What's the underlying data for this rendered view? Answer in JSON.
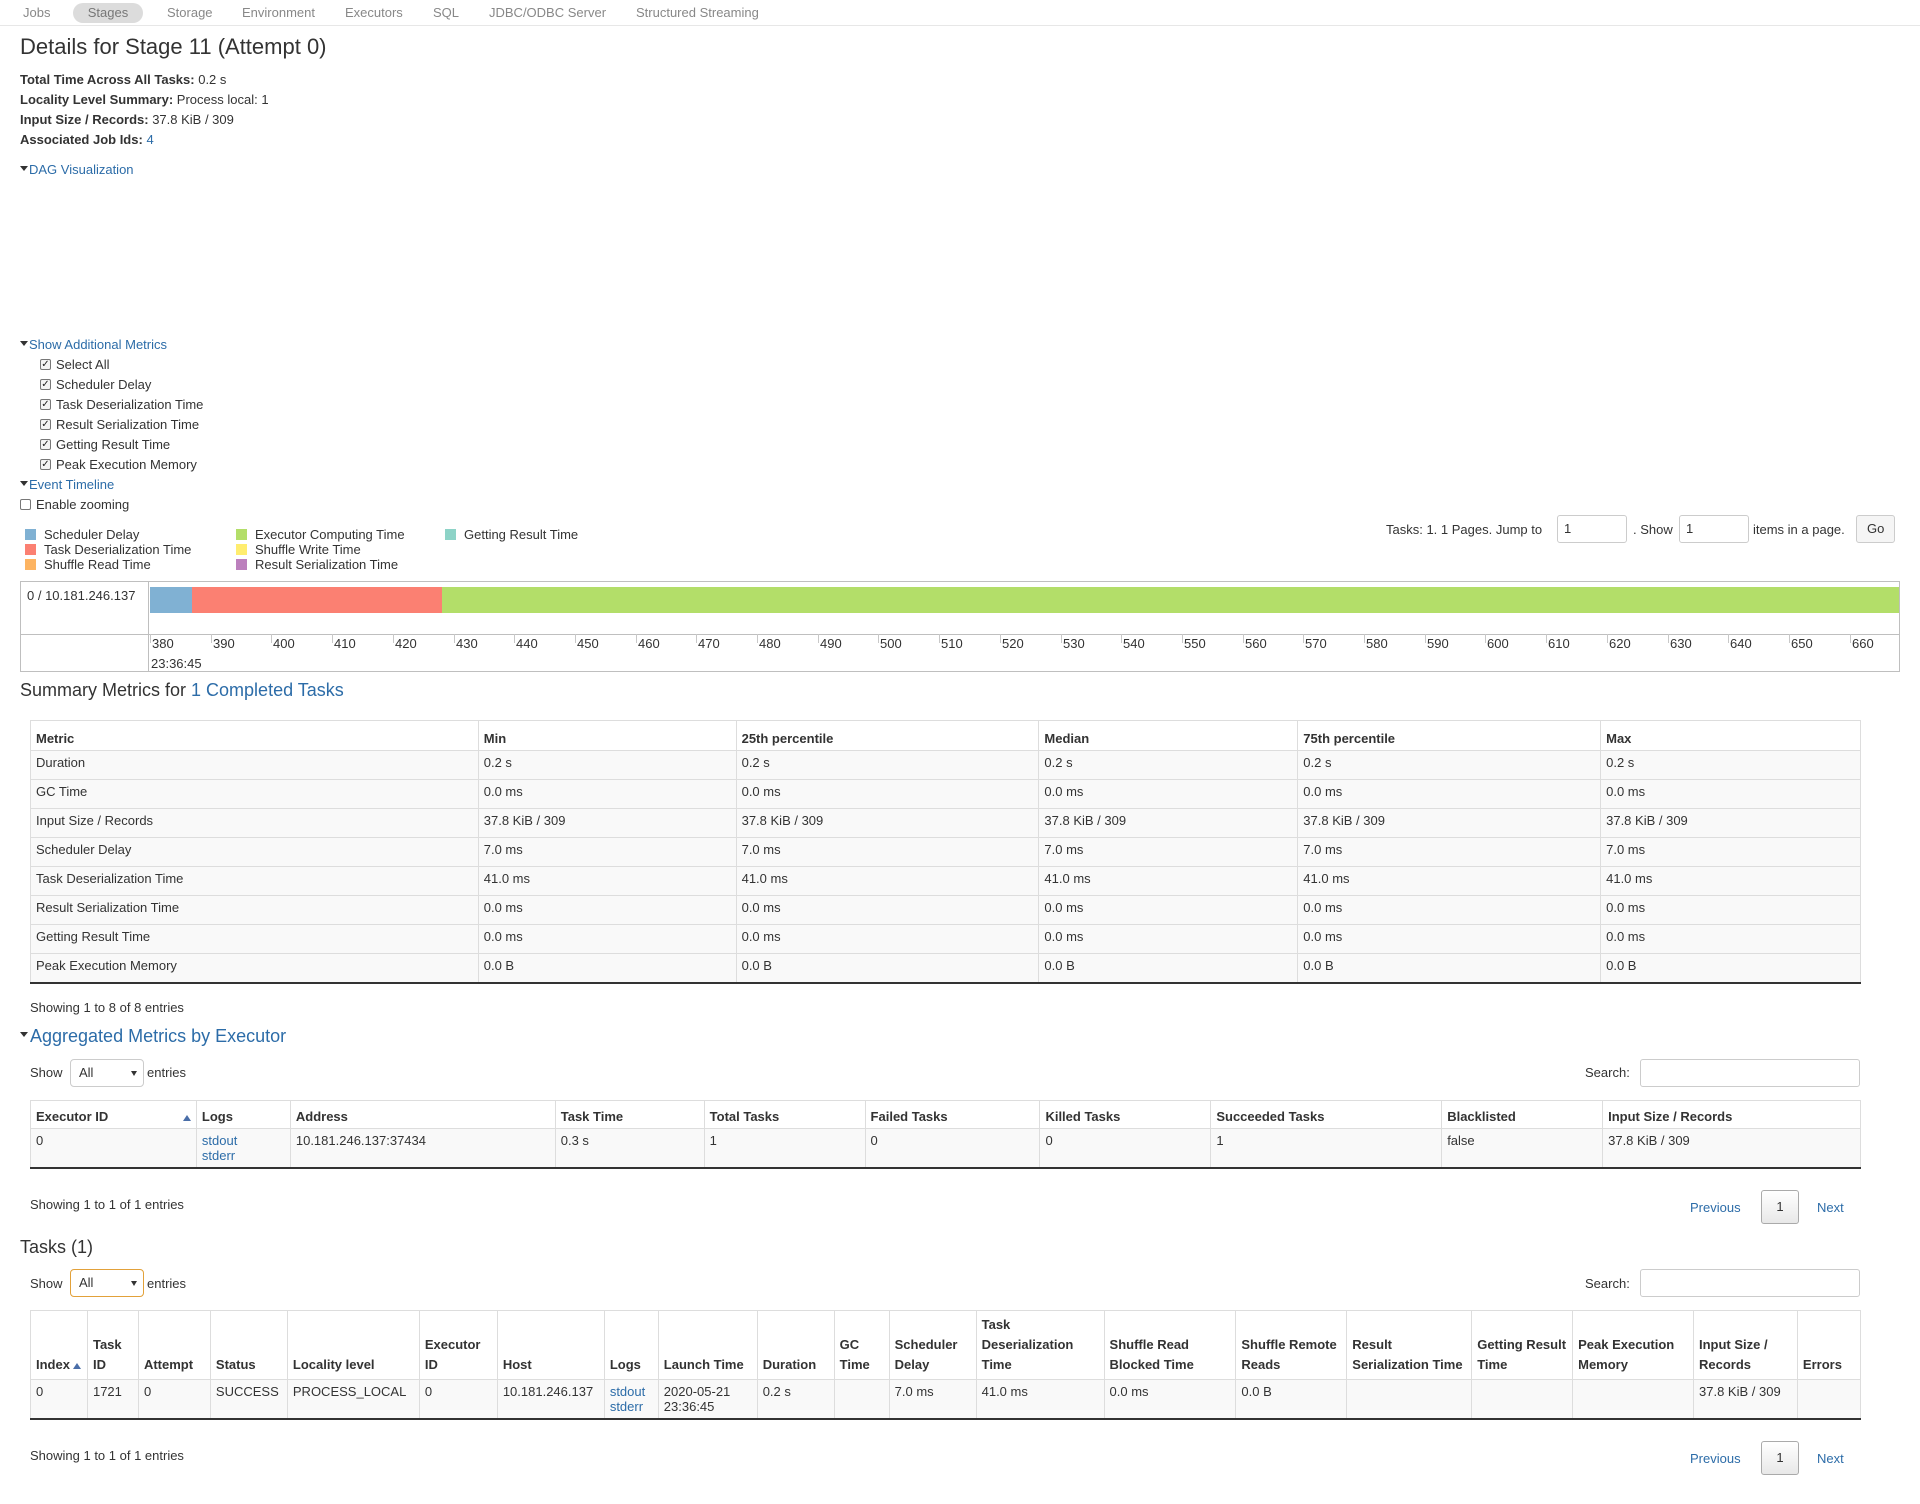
{
  "nav": {
    "items": [
      "Jobs",
      "Stages",
      "Storage",
      "Environment",
      "Executors",
      "SQL",
      "JDBC/ODBC Server",
      "Structured Streaming"
    ],
    "active": "Stages"
  },
  "title": "Details for Stage 11 (Attempt 0)",
  "summary": {
    "total_time_label": "Total Time Across All Tasks:",
    "total_time_value": "0.2 s",
    "locality_label": "Locality Level Summary:",
    "locality_value": "Process local: 1",
    "input_label": "Input Size / Records:",
    "input_value": "37.8 KiB / 309",
    "jobs_label": "Associated Job Ids:",
    "jobs_value": "4"
  },
  "dag_toggle": "DAG Visualization",
  "metrics_toggle": "Show Additional Metrics",
  "metric_checkboxes": [
    "Select All",
    "Scheduler Delay",
    "Task Deserialization Time",
    "Result Serialization Time",
    "Getting Result Time",
    "Peak Execution Memory"
  ],
  "timeline_toggle": "Event Timeline",
  "enable_zooming": "Enable zooming",
  "legend": [
    {
      "label": "Scheduler Delay",
      "color": "#80b1d3"
    },
    {
      "label": "Task Deserialization Time",
      "color": "#fb8072"
    },
    {
      "label": "Shuffle Read Time",
      "color": "#fdb462"
    },
    {
      "label": "Executor Computing Time",
      "color": "#b3de69"
    },
    {
      "label": "Shuffle Write Time",
      "color": "#ffed6f"
    },
    {
      "label": "Result Serialization Time",
      "color": "#bc80bd"
    },
    {
      "label": "Getting Result Time",
      "color": "#8dd3c7"
    }
  ],
  "paging": {
    "tasks_text": "Tasks: 1. 1 Pages. Jump to",
    "jump_value": "1",
    "show_text": ". Show",
    "show_value": "1",
    "items_text": "items in a page.",
    "go": "Go"
  },
  "timeline": {
    "host_label": "0 / 10.181.246.137",
    "ticks": [
      "380",
      "390",
      "400",
      "410",
      "420",
      "430",
      "440",
      "450",
      "460",
      "470",
      "480",
      "490",
      "500",
      "510",
      "520",
      "530",
      "540",
      "550",
      "560",
      "570",
      "580",
      "590",
      "600",
      "610",
      "620",
      "630",
      "640",
      "650",
      "660"
    ],
    "date_label": "23:36:45"
  },
  "summary_metrics": {
    "heading_prefix": "Summary Metrics for ",
    "heading_link": "1 Completed Tasks",
    "columns": [
      "Metric",
      "Min",
      "25th percentile",
      "Median",
      "75th percentile",
      "Max"
    ],
    "rows": [
      [
        "Duration",
        "0.2 s",
        "0.2 s",
        "0.2 s",
        "0.2 s",
        "0.2 s"
      ],
      [
        "GC Time",
        "0.0 ms",
        "0.0 ms",
        "0.0 ms",
        "0.0 ms",
        "0.0 ms"
      ],
      [
        "Input Size / Records",
        "37.8 KiB / 309",
        "37.8 KiB / 309",
        "37.8 KiB / 309",
        "37.8 KiB / 309",
        "37.8 KiB / 309"
      ],
      [
        "Scheduler Delay",
        "7.0 ms",
        "7.0 ms",
        "7.0 ms",
        "7.0 ms",
        "7.0 ms"
      ],
      [
        "Task Deserialization Time",
        "41.0 ms",
        "41.0 ms",
        "41.0 ms",
        "41.0 ms",
        "41.0 ms"
      ],
      [
        "Result Serialization Time",
        "0.0 ms",
        "0.0 ms",
        "0.0 ms",
        "0.0 ms",
        "0.0 ms"
      ],
      [
        "Getting Result Time",
        "0.0 ms",
        "0.0 ms",
        "0.0 ms",
        "0.0 ms",
        "0.0 ms"
      ],
      [
        "Peak Execution Memory",
        "0.0 B",
        "0.0 B",
        "0.0 B",
        "0.0 B",
        "0.0 B"
      ]
    ],
    "showing": "Showing 1 to 8 of 8 entries"
  },
  "aggregated": {
    "heading": "Aggregated Metrics by Executor",
    "show_label": "Show",
    "show_value": "All",
    "entries_label": "entries",
    "search_label": "Search:",
    "columns": [
      "Executor ID",
      "Logs",
      "Address",
      "Task Time",
      "Total Tasks",
      "Failed Tasks",
      "Killed Tasks",
      "Succeeded Tasks",
      "Blacklisted",
      "Input Size / Records"
    ],
    "row": {
      "executor_id": "0",
      "log_stdout": "stdout",
      "log_stderr": "stderr",
      "address": "10.181.246.137:37434",
      "task_time": "0.3 s",
      "total_tasks": "1",
      "failed_tasks": "0",
      "killed_tasks": "0",
      "succeeded_tasks": "1",
      "blacklisted": "false",
      "input": "37.8 KiB / 309"
    },
    "showing": "Showing 1 to 1 of 1 entries",
    "previous": "Previous",
    "page": "1",
    "next": "Next"
  },
  "tasks": {
    "heading": "Tasks (1)",
    "show_label": "Show",
    "show_value": "All",
    "entries_label": "entries",
    "search_label": "Search:",
    "columns": [
      "Index",
      "Task ID",
      "Attempt",
      "Status",
      "Locality level",
      "Executor ID",
      "Host",
      "Logs",
      "Launch Time",
      "Duration",
      "GC Time",
      "Scheduler Delay",
      "Task Deserialization Time",
      "Shuffle Read Blocked Time",
      "Shuffle Remote Reads",
      "Result Serialization Time",
      "Getting Result Time",
      "Peak Execution Memory",
      "Input Size / Records",
      "Errors"
    ],
    "row": {
      "index": "0",
      "task_id": "1721",
      "attempt": "0",
      "status": "SUCCESS",
      "locality": "PROCESS_LOCAL",
      "executor_id": "0",
      "host": "10.181.246.137",
      "log_stdout": "stdout",
      "log_stderr": "stderr",
      "launch_time": "2020-05-21 23:36:45",
      "duration": "0.2 s",
      "gc_time": "",
      "scheduler_delay": "7.0 ms",
      "task_deser": "41.0 ms",
      "shuffle_read_blocked": "0.0 ms",
      "shuffle_remote_reads": "0.0 B",
      "result_ser": "",
      "getting_result": "",
      "peak_memory": "",
      "input": "37.8 KiB / 309",
      "errors": ""
    },
    "showing": "Showing 1 to 1 of 1 entries",
    "previous": "Previous",
    "page": "1",
    "next": "Next"
  }
}
